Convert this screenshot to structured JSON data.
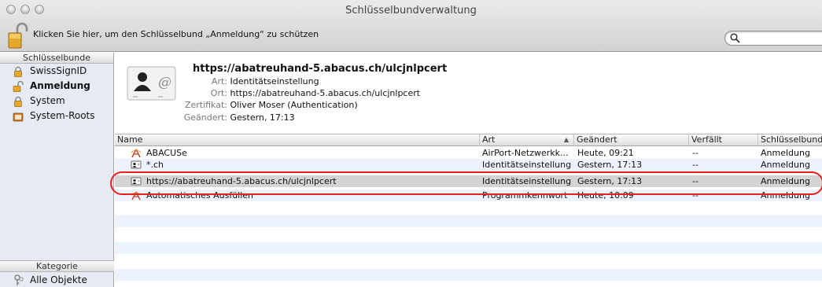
{
  "window": {
    "title": "Schlüsselbundverwaltung"
  },
  "toolbar": {
    "lock_text": "Klicken Sie hier, um den Schlüsselbund „Anmeldung“ zu schützen",
    "search_placeholder": ""
  },
  "sidebar": {
    "header": "Schlüsselbunde",
    "items": [
      {
        "label": "SwissSignID",
        "icon": "lock-icon",
        "selected": false
      },
      {
        "label": "Anmeldung",
        "icon": "lock-open-icon",
        "selected": true
      },
      {
        "label": "System",
        "icon": "lock-icon",
        "selected": false
      },
      {
        "label": "System-Roots",
        "icon": "folder-icon",
        "selected": false
      }
    ],
    "category_header": "Kategorie",
    "category_item": "Alle Objekte"
  },
  "detail": {
    "title": "https://abatreuhand-5.abacus.ch/ulcjnlpcert",
    "art_label": "Art:",
    "art_value": "Identitätseinstellung",
    "ort_label": "Ort:",
    "ort_value": "https://abatreuhand-5.abacus.ch/ulcjnlpcert",
    "zert_label": "Zertifikat:",
    "zert_value": "Oliver Moser (Authentication)",
    "geaendert_label": "Geändert:",
    "geaendert_value": "Gestern, 17:13"
  },
  "table": {
    "columns": [
      "Name",
      "Art",
      "Geändert",
      "Verfällt",
      "Schlüsselbund"
    ],
    "rows": [
      {
        "name": "ABACUSe",
        "icon": "airport-icon",
        "art": "AirPort-Netzwerkk...",
        "geaendert": "Heute, 09:21",
        "verfaellt": "--",
        "bund": "Anmeldung"
      },
      {
        "name": "*.ch",
        "icon": "identity-icon",
        "art": "Identitätseinstellung",
        "geaendert": "Gestern, 17:13",
        "verfaellt": "--",
        "bund": "Anmeldung"
      },
      {
        "name": "https://abatreuhand-5.abacus.ch/ulcjnlpcert",
        "icon": "identity-icon",
        "art": "Identitätseinstellung",
        "geaendert": "Gestern, 17:13",
        "verfaellt": "--",
        "bund": "Anmeldung"
      },
      {
        "name": "Automatisches Ausfüllen",
        "icon": "airport-icon",
        "art": "Programmkennwort",
        "geaendert": "Heute, 10:09",
        "verfaellt": "--",
        "bund": "Anmeldung"
      }
    ]
  },
  "colors": {
    "highlight_ring": "#e8201b",
    "row_alt": "#edf3fe",
    "row_selected": "#d4d4d4",
    "sidebar_bg": "#e6ebf3"
  }
}
